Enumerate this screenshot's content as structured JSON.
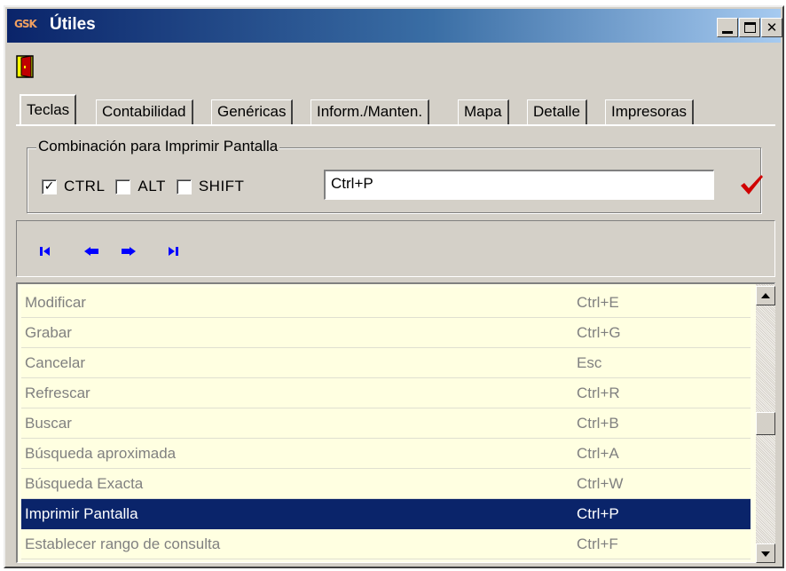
{
  "window": {
    "title": "Útiles",
    "logo_text": "GSK",
    "title_gradient_start": "#0a246a",
    "title_gradient_end": "#a6caf0"
  },
  "toolbar": {
    "exit_icon": "exit-door-icon"
  },
  "tabs": [
    {
      "label": "Teclas",
      "active": true
    },
    {
      "label": "Contabilidad",
      "active": false
    },
    {
      "label": "Genéricas",
      "active": false
    },
    {
      "label": "Inform./Manten.",
      "active": false
    },
    {
      "label": "Mapa",
      "active": false
    },
    {
      "label": "Detalle",
      "active": false
    },
    {
      "label": "Impresoras",
      "active": false
    }
  ],
  "print_screen": {
    "group_title": "Combinación para Imprimir Pantalla",
    "ctrl_label": "CTRL",
    "ctrl_checked": true,
    "alt_label": "ALT",
    "alt_checked": false,
    "shift_label": "SHIFT",
    "shift_checked": false,
    "shortcut_value": "Ctrl+P",
    "confirm_icon": "red-checkmark-icon",
    "confirm_color": "#d00000"
  },
  "navigator": {
    "buttons": [
      "first-record-icon",
      "prior-record-icon",
      "next-record-icon",
      "last-record-icon"
    ],
    "color": "#0000ff"
  },
  "shortcuts": [
    {
      "action": "Modificar",
      "key": "Ctrl+E",
      "selected": false
    },
    {
      "action": "Grabar",
      "key": "Ctrl+G",
      "selected": false
    },
    {
      "action": "Cancelar",
      "key": "Esc",
      "selected": false
    },
    {
      "action": "Refrescar",
      "key": "Ctrl+R",
      "selected": false
    },
    {
      "action": "Buscar",
      "key": "Ctrl+B",
      "selected": false
    },
    {
      "action": "Búsqueda aproximada",
      "key": "Ctrl+A",
      "selected": false
    },
    {
      "action": "Búsqueda Exacta",
      "key": "Ctrl+W",
      "selected": false
    },
    {
      "action": "Imprimir Pantalla",
      "key": "Ctrl+P",
      "selected": true
    },
    {
      "action": "Establecer rango de consulta",
      "key": "Ctrl+F",
      "selected": false
    }
  ]
}
